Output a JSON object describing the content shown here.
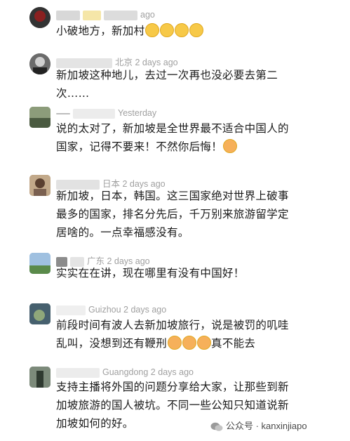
{
  "comments": [
    {
      "meta": "ago",
      "text": "小破地方，新加村",
      "emoji_count": 4
    },
    {
      "meta": "北京 2 days ago",
      "text": "新加坡这种地儿，去过一次再也没必要去第二次……"
    },
    {
      "meta": "Yesterday",
      "text": "说的太对了，新加坡是全世界最不适合中国人的国家，记得不要来！不然你后悔！"
    },
    {
      "meta": "日本 2 days ago",
      "text": "新加坡，日本，韩国。这三国家绝对世界上破事最多的国家，排名分先后，千万别来旅游留学定居啥的。一点幸福感没有。"
    },
    {
      "meta": "广东 2 days ago",
      "text": "实实在在讲，现在哪里有没有中国好！"
    },
    {
      "meta": "Guizhou 2 days ago",
      "text_before": "前段时间有波人去新加坡旅行，说是被罚的叽哇乱叫，没想到还有鞭刑",
      "text_after": "真不能去"
    },
    {
      "meta": "Guangdong 2 days ago",
      "text": "支持主播将外国的问题分享给大家，让那些到新加坡旅游的国人被坑。不同一些公知只知道说新加坡如何的好。"
    }
  ],
  "footer": {
    "label": "公众号 · kanxinjiapo"
  }
}
